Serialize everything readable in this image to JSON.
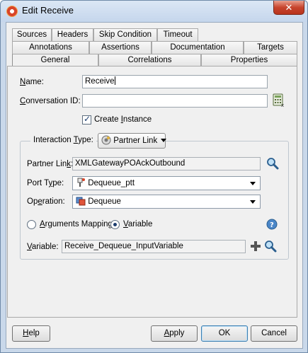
{
  "window": {
    "title": "Edit Receive",
    "close_glyph": "✕"
  },
  "tabs": {
    "row1": [
      "Sources",
      "Headers",
      "Skip Condition",
      "Timeout"
    ],
    "row2": [
      "Annotations",
      "Assertions",
      "Documentation",
      "Targets"
    ],
    "row3": [
      "General",
      "Correlations",
      "Properties"
    ],
    "active": "General"
  },
  "form": {
    "name_label": "Name:",
    "name_value": "Receive",
    "conversation_label": "Conversation ID:",
    "conversation_value": "",
    "create_instance_label": "Create Instance",
    "create_instance_checked": true,
    "interaction_label": "Interaction Type:",
    "interaction_value": "Partner Link",
    "partner_link_label": "Partner Link:",
    "partner_link_value": "XMLGatewayPOAckOutbound",
    "port_type_label": "Port Type:",
    "port_type_value": "Dequeue_ptt",
    "operation_label": "Operation:",
    "operation_value": "Dequeue",
    "arguments_mapping_label": "Arguments Mapping",
    "variable_radio_label": "Variable",
    "selected_radio": "Variable",
    "variable_label": "Variable:",
    "variable_value": "Receive_Dequeue_InputVariable"
  },
  "buttons": {
    "help": "Help",
    "apply": "Apply",
    "ok": "OK",
    "cancel": "Cancel"
  },
  "icons": {
    "app": "oracle-bpel-icon",
    "expression": "expression-builder-icon",
    "search": "search-icon",
    "help": "help-icon",
    "add": "add-icon"
  }
}
